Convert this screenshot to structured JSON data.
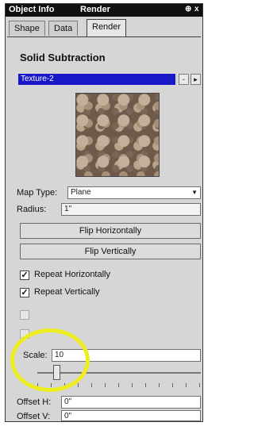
{
  "window": {
    "tabs_title": [
      "Object Info",
      "Render"
    ],
    "pin_glyph": "⊕",
    "close_glyph": "x"
  },
  "tabs": [
    "Shape",
    "Data",
    "Render"
  ],
  "active_tab": "Render",
  "section_title": "Solid Subtraction",
  "texture": {
    "selected": "Texture-2",
    "minus_glyph": "-",
    "arrow_glyph": "▸"
  },
  "map_type": {
    "label": "Map Type:",
    "value": "Plane"
  },
  "radius": {
    "label": "Radius:",
    "value": "1\""
  },
  "buttons": {
    "flip_h": "Flip Horizontally",
    "flip_v": "Flip Vertically"
  },
  "repeat_h": {
    "label": "Repeat Horizontally",
    "checked": true
  },
  "repeat_v": {
    "label": "Repeat Vertically",
    "checked": true
  },
  "scale": {
    "label": "Scale:",
    "value": "10"
  },
  "offset_h": {
    "label": "Offset H:",
    "value": "0\""
  },
  "offset_v": {
    "label": "Offset V:",
    "value": "0\""
  },
  "colors": {
    "selection": "#1818c8",
    "highlight_circle": "#ecec1e"
  }
}
